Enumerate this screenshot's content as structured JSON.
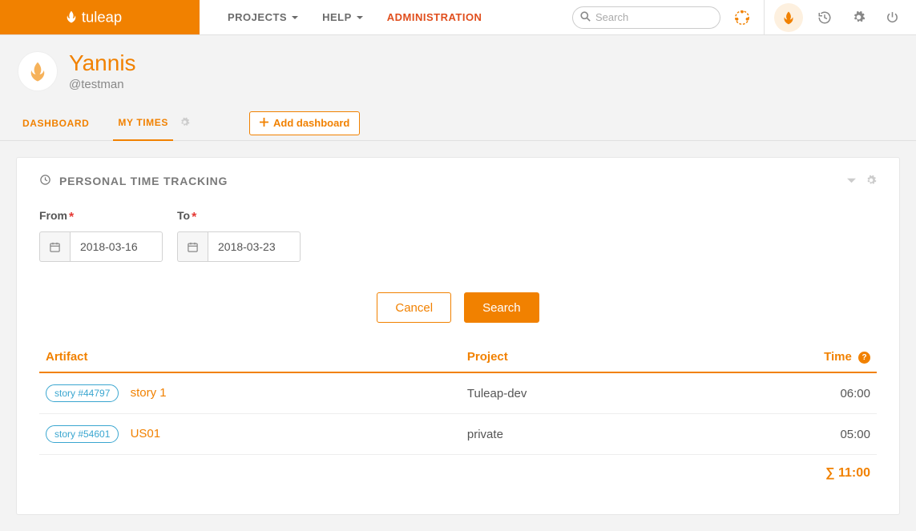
{
  "brand": "tuleap",
  "nav": {
    "projects": "PROJECTS",
    "help": "HELP",
    "administration": "ADMINISTRATION",
    "search_placeholder": "Search"
  },
  "user": {
    "name": "Yannis",
    "handle": "@testman"
  },
  "tabs": {
    "dashboard": "DASHBOARD",
    "mytimes": "MY TIMES",
    "add_dashboard": "Add dashboard"
  },
  "panel": {
    "title": "PERSONAL TIME TRACKING",
    "from_label": "From",
    "to_label": "To",
    "from_value": "2018-03-16",
    "to_value": "2018-03-23",
    "cancel": "Cancel",
    "search": "Search"
  },
  "table": {
    "headers": {
      "artifact": "Artifact",
      "project": "Project",
      "time": "Time"
    },
    "rows": [
      {
        "badge": "story #44797",
        "title": "story 1",
        "project": "Tuleap-dev",
        "time": "06:00"
      },
      {
        "badge": "story #54601",
        "title": "US01",
        "project": "private",
        "time": "05:00"
      }
    ],
    "sum_symbol": "∑",
    "total": "11:00"
  }
}
